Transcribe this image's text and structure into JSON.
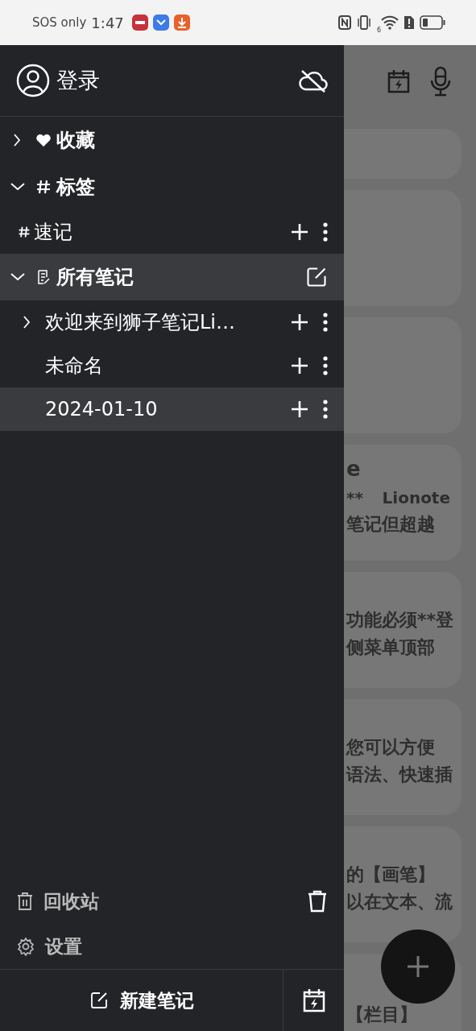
{
  "status_bar": {
    "carrier": "SOS only",
    "time": "1:47",
    "wifi_badge": "6"
  },
  "drawer": {
    "account": {
      "label": "登录"
    },
    "sections": [
      {
        "kind": "favorites",
        "label": "收藏",
        "expanded": false,
        "selected": false
      },
      {
        "kind": "tags",
        "label": "标签",
        "expanded": true,
        "selected": false,
        "children": [
          {
            "kind": "tag",
            "label": "速记",
            "selected": false
          }
        ]
      },
      {
        "kind": "notes",
        "label": "所有笔记",
        "expanded": true,
        "selected": true,
        "children": [
          {
            "kind": "note",
            "label": "欢迎来到狮子笔记Li…",
            "has_children": true,
            "selected": false
          },
          {
            "kind": "note",
            "label": "未命名",
            "has_children": false,
            "selected": false
          },
          {
            "kind": "note",
            "label": "2024-01-10",
            "has_children": false,
            "selected": true
          }
        ]
      }
    ],
    "footer_items": [
      {
        "kind": "trash",
        "label": "回收站"
      },
      {
        "kind": "settings",
        "label": "设置"
      }
    ],
    "new_note": {
      "label": "新建笔记"
    }
  },
  "background_cards": [
    {
      "kind": "note"
    },
    {
      "kind": "note"
    },
    {
      "kind": "note"
    },
    {
      "kind": "note",
      "title": "e",
      "meta": [
        "**",
        "Lionote"
      ],
      "lines": [
        "笔记但超越"
      ]
    },
    {
      "kind": "note",
      "lines": [
        "功能必须**登",
        "侧菜单顶部"
      ]
    },
    {
      "kind": "note",
      "lines": [
        "您可以方便",
        "语法、快速插"
      ]
    },
    {
      "kind": "note",
      "lines": [
        "的【画笔】",
        "以在文本、流"
      ]
    },
    {
      "kind": "note_partial",
      "lines": [
        "【栏目】"
      ]
    }
  ]
}
